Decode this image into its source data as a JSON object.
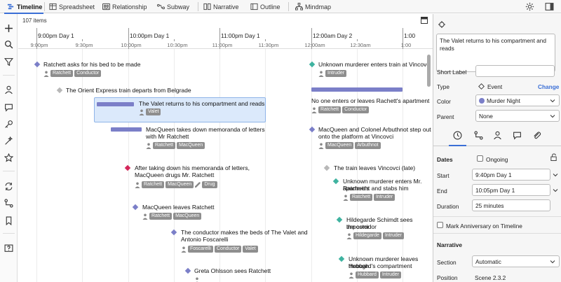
{
  "tabs": [
    {
      "label": "Timeline",
      "icon": "timeline-icon"
    },
    {
      "label": "Spreadsheet",
      "icon": "spreadsheet-icon"
    },
    {
      "label": "Relationship",
      "icon": "relationship-icon"
    },
    {
      "label": "Subway",
      "icon": "subway-icon"
    },
    {
      "label": "Narrative",
      "icon": "narrative-icon"
    },
    {
      "label": "Outline",
      "icon": "outline-icon"
    },
    {
      "label": "Mindmap",
      "icon": "mindmap-icon"
    }
  ],
  "timeline": {
    "items_count": "107 items",
    "major_labels": [
      "9:00pm Day 1",
      "10:00pm Day 1",
      "11:00pm Day 1",
      "12:00am Day 2",
      "1:00"
    ],
    "minor_labels": [
      "9:00pm",
      "9:30pm",
      "10:00pm",
      "10:30pm",
      "11:00pm",
      "11:30pm",
      "12:00am",
      "12:30am",
      "1:00"
    ],
    "events": [
      {
        "title": "Ratchett asks for his bed to be made",
        "tags": [
          "Ratchett",
          "Conductor"
        ]
      },
      {
        "title": "The Orient Express train departs from Belgrade",
        "tags": []
      },
      {
        "title": "The Valet returns to his compartment and reads",
        "tags": [
          "Valet"
        ]
      },
      {
        "title": "MacQueen takes down memoranda of letters",
        "title2": "with Mr Ratchett",
        "tags": [
          "Ratchett",
          "MacQueen"
        ]
      },
      {
        "title": "After taking down his memoranda of letters,",
        "title2": "MacQueen drugs Mr. Ratchett",
        "tags": [
          "Ratchett",
          "MacQueen"
        ],
        "extra_tag": "Drug"
      },
      {
        "title": "MacQueen leaves Ratchett",
        "tags": [
          "Ratchett",
          "MacQueen"
        ]
      },
      {
        "title": "The conductor makes the beds of The Valet and",
        "title2": "Antonio Foscarelli",
        "tags": [
          "Foscarelli",
          "Conductor",
          "Valet"
        ]
      },
      {
        "title": "Greta Ohlsson sees Ratchett",
        "tags": []
      },
      {
        "title": "Unknown murderer enters train at Vincovci",
        "tags": [
          "Intruder"
        ]
      },
      {
        "title": "No one enters or leaves Rachett's apartment",
        "tags": [
          "Ratchett",
          "Conductor"
        ]
      },
      {
        "title": "MacQueen and Colonel Arbuthnot step out",
        "title2": "onto the platform at Vincovci",
        "tags": [
          "MacQueen",
          "Arbuthnot"
        ]
      },
      {
        "title": "The train leaves Vincovci (late)",
        "tags": []
      },
      {
        "title": "Unknown murderer enters Mr. Ratchett's",
        "title2": "apartment and stabs him",
        "tags": [
          "Ratchett",
          "Intruder"
        ]
      },
      {
        "title": "Hildegarde Schimdt sees impostor",
        "title2": "the corridor",
        "tags": [
          "Hildegarde",
          "Intruder"
        ]
      },
      {
        "title": "Unknown murderer leaves through",
        "title2": "Hubbard's compartment",
        "tags": [
          "Hubbard",
          "Intruder"
        ]
      }
    ]
  },
  "panel": {
    "title_text": "The Valet returns to his compartment and reads",
    "short_label": {
      "label": "Short Label",
      "value": ""
    },
    "type": {
      "label": "Type",
      "value": "Event",
      "action": "Change"
    },
    "color": {
      "label": "Color",
      "value": "Murder Night",
      "swatch": "#7b7fc8"
    },
    "parent": {
      "label": "Parent",
      "value": "None"
    },
    "dates": {
      "heading": "Dates",
      "ongoing": "Ongoing",
      "start_label": "Start",
      "start": "9:40pm Day 1",
      "end_label": "End",
      "end": "10:05pm Day 1",
      "duration_label": "Duration",
      "duration": "25 minutes"
    },
    "anniversary": "Mark Anniversary on Timeline",
    "narrative": {
      "heading": "Narrative",
      "section_label": "Section",
      "section": "Automatic",
      "position_label": "Position",
      "position": "Scene 2.3.2"
    }
  },
  "colors": {
    "murder_night": "#7b7fc8",
    "teal": "#3fb3a0",
    "grey": "#b8b8b8",
    "crimson": "#d4265a",
    "selection": "#dbe9fb",
    "accent": "#3b6fd6"
  }
}
